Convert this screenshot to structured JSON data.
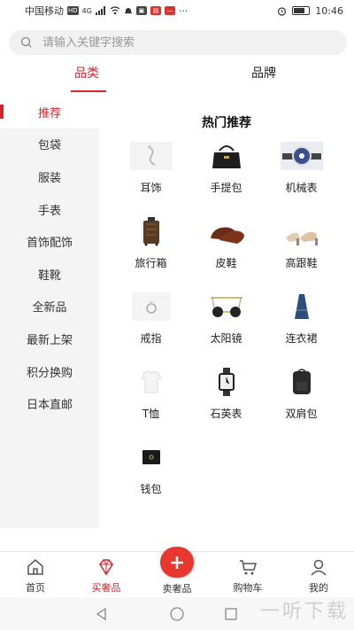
{
  "status_bar": {
    "carrier": "中国移动",
    "hd_badge": "HD",
    "network": "4G",
    "time": "10:46"
  },
  "search": {
    "placeholder": "请输入关键字搜索"
  },
  "top_tabs": [
    {
      "label": "品类",
      "active": true
    },
    {
      "label": "品牌",
      "active": false
    }
  ],
  "sidebar": {
    "items": [
      {
        "label": "推荐",
        "active": true
      },
      {
        "label": "包袋"
      },
      {
        "label": "服装"
      },
      {
        "label": "手表"
      },
      {
        "label": "首饰配饰"
      },
      {
        "label": "鞋靴"
      },
      {
        "label": "全新品"
      },
      {
        "label": "最新上架"
      },
      {
        "label": "积分换购"
      },
      {
        "label": "日本直邮"
      }
    ]
  },
  "main": {
    "section_title": "热门推荐",
    "items": [
      {
        "label": "耳饰",
        "icon": "earring-icon"
      },
      {
        "label": "手提包",
        "icon": "handbag-icon"
      },
      {
        "label": "机械表",
        "icon": "watch-icon"
      },
      {
        "label": "旅行箱",
        "icon": "suitcase-icon"
      },
      {
        "label": "皮鞋",
        "icon": "leather-shoes-icon"
      },
      {
        "label": "高跟鞋",
        "icon": "high-heels-icon"
      },
      {
        "label": "戒指",
        "icon": "ring-icon"
      },
      {
        "label": "太阳镜",
        "icon": "sunglasses-icon"
      },
      {
        "label": "连衣裙",
        "icon": "dress-icon"
      },
      {
        "label": "T恤",
        "icon": "tshirt-icon"
      },
      {
        "label": "石英表",
        "icon": "quartz-watch-icon"
      },
      {
        "label": "双肩包",
        "icon": "backpack-icon"
      },
      {
        "label": "钱包",
        "icon": "wallet-icon"
      }
    ]
  },
  "bottom_nav": [
    {
      "label": "首页",
      "icon": "home-icon"
    },
    {
      "label": "买奢品",
      "icon": "diamond-icon",
      "active": true
    },
    {
      "label": "卖奢品",
      "icon": "plus-icon"
    },
    {
      "label": "购物车",
      "icon": "cart-icon"
    },
    {
      "label": "我的",
      "icon": "user-icon"
    }
  ],
  "watermark": "一听下载",
  "colors": {
    "accent": "#d6252c",
    "sidebar_bg": "#f4f4f4",
    "sell_button": "#e7372e"
  }
}
